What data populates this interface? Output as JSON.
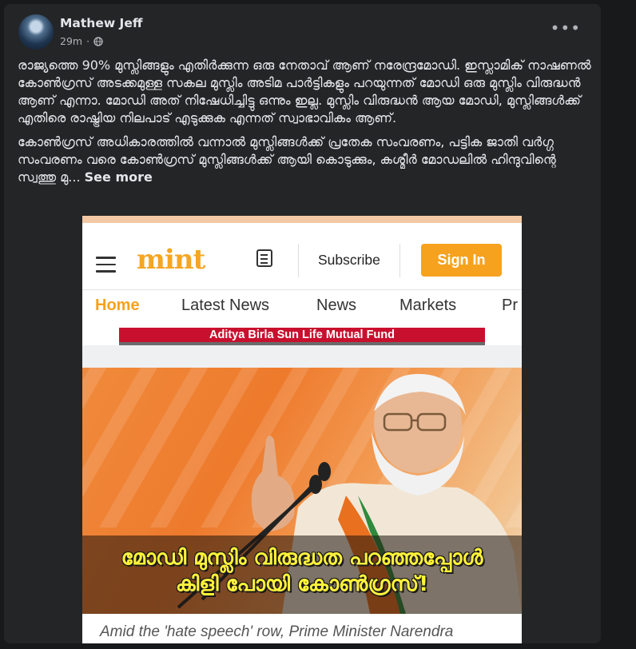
{
  "post": {
    "author": "Mathew Jeff",
    "time": "29m",
    "visibility_icon": "globe-icon",
    "more_icon": "more-options-icon",
    "more_label": "•••",
    "paragraph1": "രാജ്യത്തെ 90% മുസ്ലിങ്ങളും എതിർക്കുന്ന ഒരു നേതാവ് ആണ് നരേന്ദ്രമോഡി. ഇസ്ലാമിക് നാഷണൽ കോൺഗ്രസ് അടക്കമുള്ള സകല മുസ്ലിം അടിമ പാർട്ടികളും പറയുന്നത് മോഡി ഒരു മുസ്ലിം വിരുദ്ധൻ ആണ് എന്നാ. മോഡി അത് നിഷേധിച്ചിട്ടു ഒന്നും ഇല്ല. മുസ്ലിം വിരുദ്ധൻ ആയ മോഡി, മുസ്ലിങ്ങൾക്ക് എതിരെ രാഷ്ട്രിയ നിലപാട് എടുക്കുക എന്നത് സ്വാഭാവികം ആണ്.",
    "paragraph2": "കോൺഗ്രസ് അധികാരത്തിൽ വന്നാൽ മുസ്ലിങ്ങൾക്ക് പ്രതേക സംവരണം, പട്ടിക ജാതി വർഗ്ഗ സംവരണം വരെ കോൺഗ്രസ് മുസ്ലിങ്ങൾക്ക് ആയി കൊടുക്കും, കശ്മീർ മോഡലിൽ ഹിന്ദുവിന്റെ സ്വത്തു മു...",
    "see_more": "See more"
  },
  "screenshot": {
    "logo": "mint",
    "subscribe": "Subscribe",
    "sign_in": "Sign In",
    "nav": [
      "Home",
      "Latest News",
      "News",
      "Markets",
      "Pr"
    ],
    "ad_text": "Aditya Birla Sun Life Mutual Fund",
    "overlay_line1": "മോഡി മുസ്ലിം വിരുദ്ധത പറഞ്ഞപ്പോൾ",
    "overlay_line2": "കിളി പോയി കോൺഗ്രസ്!",
    "caption": "Amid the 'hate speech' row, Prime Minister Narendra",
    "accent_color": "#f6a21e",
    "ad_color": "#c8102e"
  }
}
